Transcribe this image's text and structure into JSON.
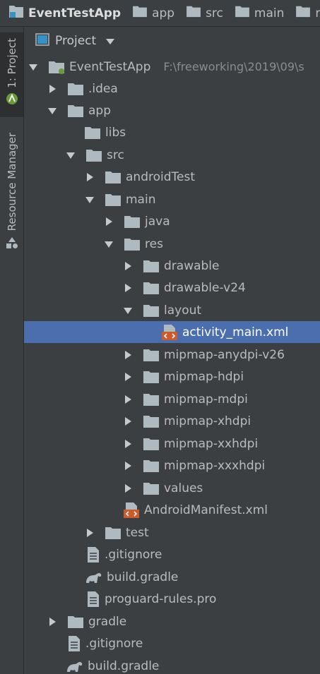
{
  "breadcrumb": {
    "items": [
      "EventTestApp",
      "app",
      "src",
      "main",
      "re"
    ]
  },
  "toolstrip": {
    "project_tab": "1: Project",
    "resource_tab": "Resource Manager"
  },
  "panel": {
    "title": "Project"
  },
  "tree": {
    "root_label": "EventTestApp",
    "root_path": "F:\\freeworking\\2019\\09\\s",
    "items": [
      {
        "label": ".idea"
      },
      {
        "label": "app"
      },
      {
        "label": "libs"
      },
      {
        "label": "src"
      },
      {
        "label": "androidTest"
      },
      {
        "label": "main"
      },
      {
        "label": "java"
      },
      {
        "label": "res"
      },
      {
        "label": "drawable"
      },
      {
        "label": "drawable-v24"
      },
      {
        "label": "layout"
      },
      {
        "label": "activity_main.xml"
      },
      {
        "label": "mipmap-anydpi-v26"
      },
      {
        "label": "mipmap-hdpi"
      },
      {
        "label": "mipmap-mdpi"
      },
      {
        "label": "mipmap-xhdpi"
      },
      {
        "label": "mipmap-xxhdpi"
      },
      {
        "label": "mipmap-xxxhdpi"
      },
      {
        "label": "values"
      },
      {
        "label": "AndroidManifest.xml"
      },
      {
        "label": "test"
      },
      {
        "label": ".gitignore"
      },
      {
        "label": "build.gradle"
      },
      {
        "label": "proguard-rules.pro"
      },
      {
        "label": "gradle"
      },
      {
        "label": ".gitignore"
      },
      {
        "label": "build.gradle"
      }
    ]
  },
  "colors": {
    "background": "#3c3f41",
    "selection": "#4b6eaf",
    "folder": "#aeb9c0",
    "xml_badge": "#cc5a2a"
  }
}
